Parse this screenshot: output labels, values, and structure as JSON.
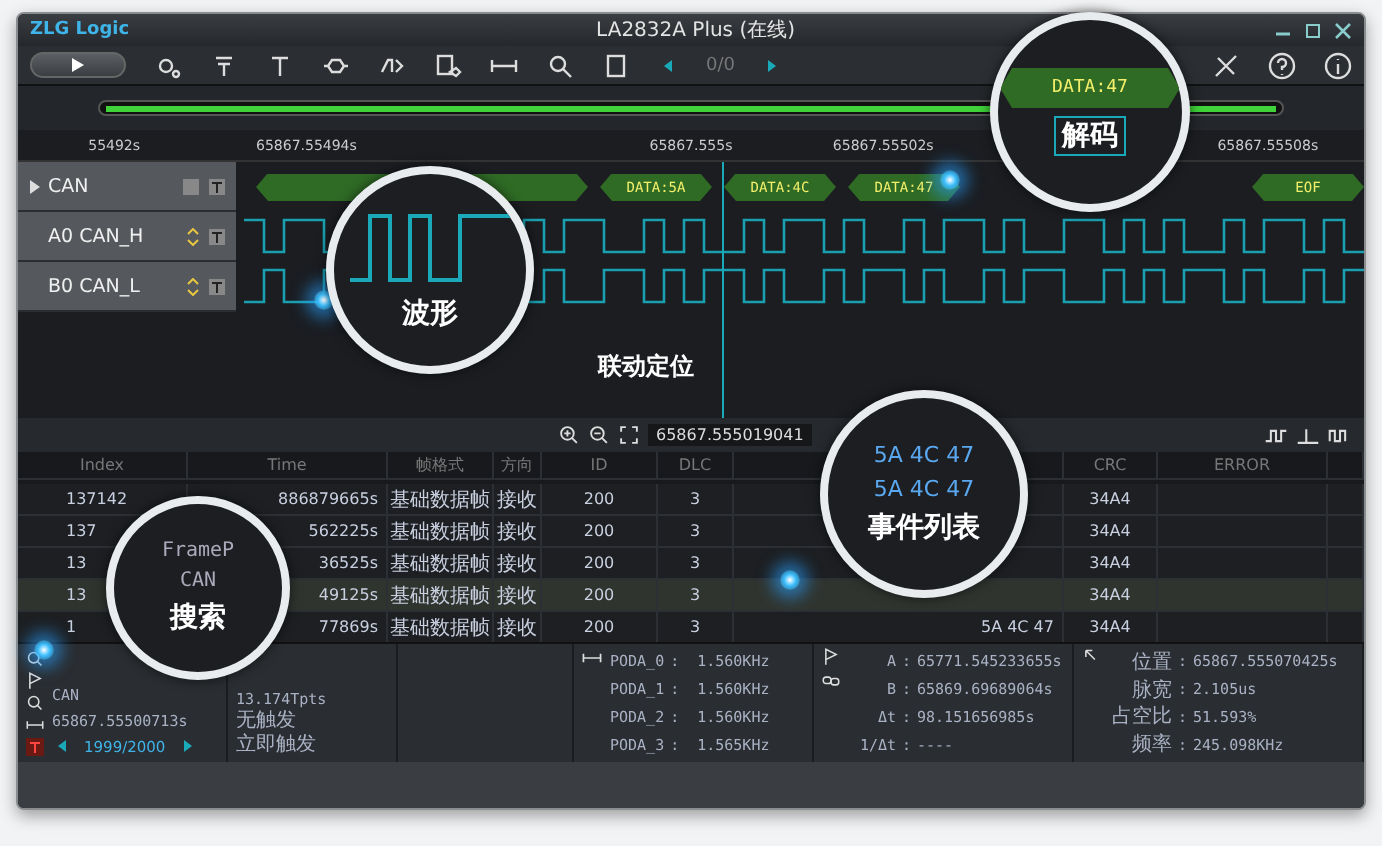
{
  "window": {
    "brand": "ZLG Logic",
    "title": "LA2832A Plus (在线)"
  },
  "toolbar": {
    "pager": "0/0"
  },
  "ruler": {
    "ticks": [
      "55492s",
      "65867.55494s",
      "65867.555s",
      "65867.55502s",
      "65867.55508s"
    ]
  },
  "channels": [
    {
      "name": "CAN",
      "kind": "bus",
      "expanded": false
    },
    {
      "name": "A0 CAN_H",
      "kind": "digital"
    },
    {
      "name": "B0 CAN_L",
      "kind": "digital"
    }
  ],
  "decode": [
    "DATA:5A",
    "DATA:4C",
    "DATA:47",
    "EOF"
  ],
  "annotation": "联动定位",
  "wave_footer": {
    "time": "65867.555019041"
  },
  "table": {
    "columns": [
      "Index",
      "Time",
      "帧格式",
      "方向",
      "ID",
      "DLC",
      "CRC",
      "ERROR"
    ],
    "rows": [
      {
        "index": "137142",
        "time": "886879665s",
        "format": "基础数据帧",
        "direction": "接收",
        "id": "200",
        "dlc": "3",
        "crc": "34A4",
        "selected": false
      },
      {
        "index": "137",
        "time": "562225s",
        "format": "基础数据帧",
        "direction": "接收",
        "id": "200",
        "dlc": "3",
        "crc": "34A4",
        "selected": false
      },
      {
        "index": "13",
        "time": "36525s",
        "format": "基础数据帧",
        "direction": "接收",
        "id": "200",
        "dlc": "3",
        "crc": "34A4",
        "selected": false
      },
      {
        "index": "13",
        "time": "49125s",
        "format": "基础数据帧",
        "direction": "接收",
        "id": "200",
        "dlc": "3",
        "crc": "34A4",
        "selected": true
      },
      {
        "index": "1",
        "time": "77869s",
        "format": "基础数据帧",
        "direction": "接收",
        "id": "200",
        "dlc": "3",
        "data": "5A 4C 47",
        "crc": "34A4",
        "selected": false
      }
    ]
  },
  "callouts": [
    {
      "kind": "wave",
      "label": "波形"
    },
    {
      "kind": "decode",
      "label": "解码",
      "segment": "DATA:47"
    },
    {
      "kind": "events",
      "label": "事件列表",
      "lines": [
        "5A 4C 47",
        "5A 4C 47"
      ]
    },
    {
      "kind": "search",
      "label": "搜索",
      "lines": [
        "FrameP",
        "CAN"
      ]
    }
  ],
  "search_panel": {
    "lines": [
      "CAN",
      "65867.55500713s"
    ],
    "pager": "1999/2000"
  },
  "info_panel": [
    "13.174Tpts",
    "无触发",
    "立即触发"
  ],
  "separator": ":",
  "freq_panel": [
    {
      "name": "PODA_0",
      "value": "1.560KHz"
    },
    {
      "name": "PODA_1",
      "value": "1.560KHz"
    },
    {
      "name": "PODA_2",
      "value": "1.560KHz"
    },
    {
      "name": "PODA_3",
      "value": "1.565KHz"
    }
  ],
  "cursor_panel": [
    {
      "name": "A",
      "value": "65771.545233655s"
    },
    {
      "name": "B",
      "value": "65869.69689064s"
    },
    {
      "name": "Δt",
      "value": "98.151656985s"
    },
    {
      "name": "1/Δt",
      "value": "----"
    }
  ],
  "measure_panel": [
    {
      "name": "位置",
      "value": "65867.555070425s"
    },
    {
      "name": "脉宽",
      "value": "2.105us"
    },
    {
      "name": "占空比",
      "value": "51.593%"
    },
    {
      "name": "频率",
      "value": "245.098KHz"
    }
  ]
}
